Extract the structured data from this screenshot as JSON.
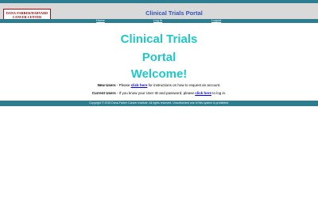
{
  "logo": {
    "line1": "DANA-FARBER/HARVARD",
    "line2": "CANCER CENTER"
  },
  "header": {
    "title": "Clinical Trials Portal"
  },
  "nav": {
    "home": "Home",
    "login": "Log In",
    "logout": "Logout"
  },
  "main": {
    "heading1": "Clinical Trials",
    "heading2": "Portal",
    "heading3": "Welcome!",
    "new_users_label": "New Users",
    "new_users_pre": " - Please ",
    "new_users_link": "click here",
    "new_users_post": " for instructions on how to request an account.",
    "current_users_label": "Current Users",
    "current_users_pre": " - If you know your User ID and password, please ",
    "current_users_link": "click here",
    "current_users_post": " to log in."
  },
  "footer": {
    "copyright": "Copyright © 2016 Dana-Farber Cancer Institute. All rights reserved. Unauthorized use of this system is prohibited."
  },
  "colors": {
    "nav_bar": "#2b7d8f",
    "header_bg": "#d9d9d9",
    "headline": "#1ec8c8",
    "portal_title": "#3355bb",
    "logo_text": "#8b0000"
  }
}
